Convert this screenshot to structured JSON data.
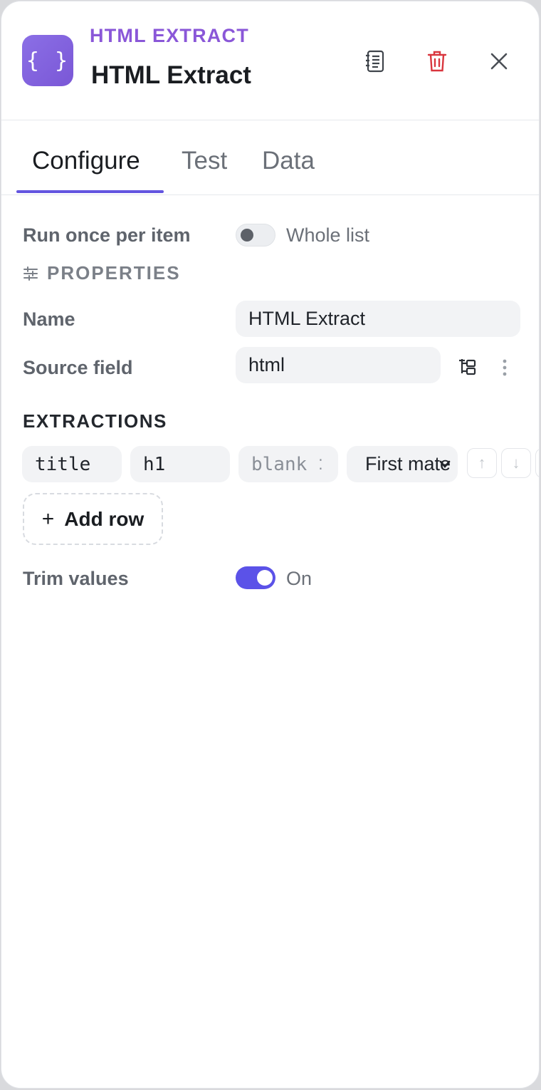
{
  "header": {
    "node_icon_glyph": "{ }",
    "node_type": "HTML EXTRACT",
    "node_title": "HTML Extract",
    "accent_color": "#8a57d8",
    "actions": [
      "docs-icon",
      "trash-icon",
      "close-icon"
    ]
  },
  "tabs": [
    {
      "label": "Configure",
      "active": true
    },
    {
      "label": "Test",
      "active": false
    },
    {
      "label": "Data",
      "active": false
    }
  ],
  "run_mode": {
    "label": "Run once per item",
    "toggle_on": false,
    "toggle_label": "Whole list"
  },
  "properties": {
    "section_label": "PROPERTIES",
    "name": {
      "label": "Name",
      "value": "HTML Extract"
    },
    "source_field": {
      "label": "Source field",
      "value": "html"
    }
  },
  "extractions": {
    "section_label": "EXTRACTIONS",
    "rows": [
      {
        "key": "title",
        "selector": "h1",
        "attribute_placeholder": "blank",
        "mode": "First mate"
      }
    ],
    "add_row_label": "Add row",
    "add_row_icon": "+"
  },
  "trim": {
    "label": "Trim values",
    "toggle_on": true,
    "toggle_label": "On",
    "toggle_color": "#5b52e8"
  }
}
